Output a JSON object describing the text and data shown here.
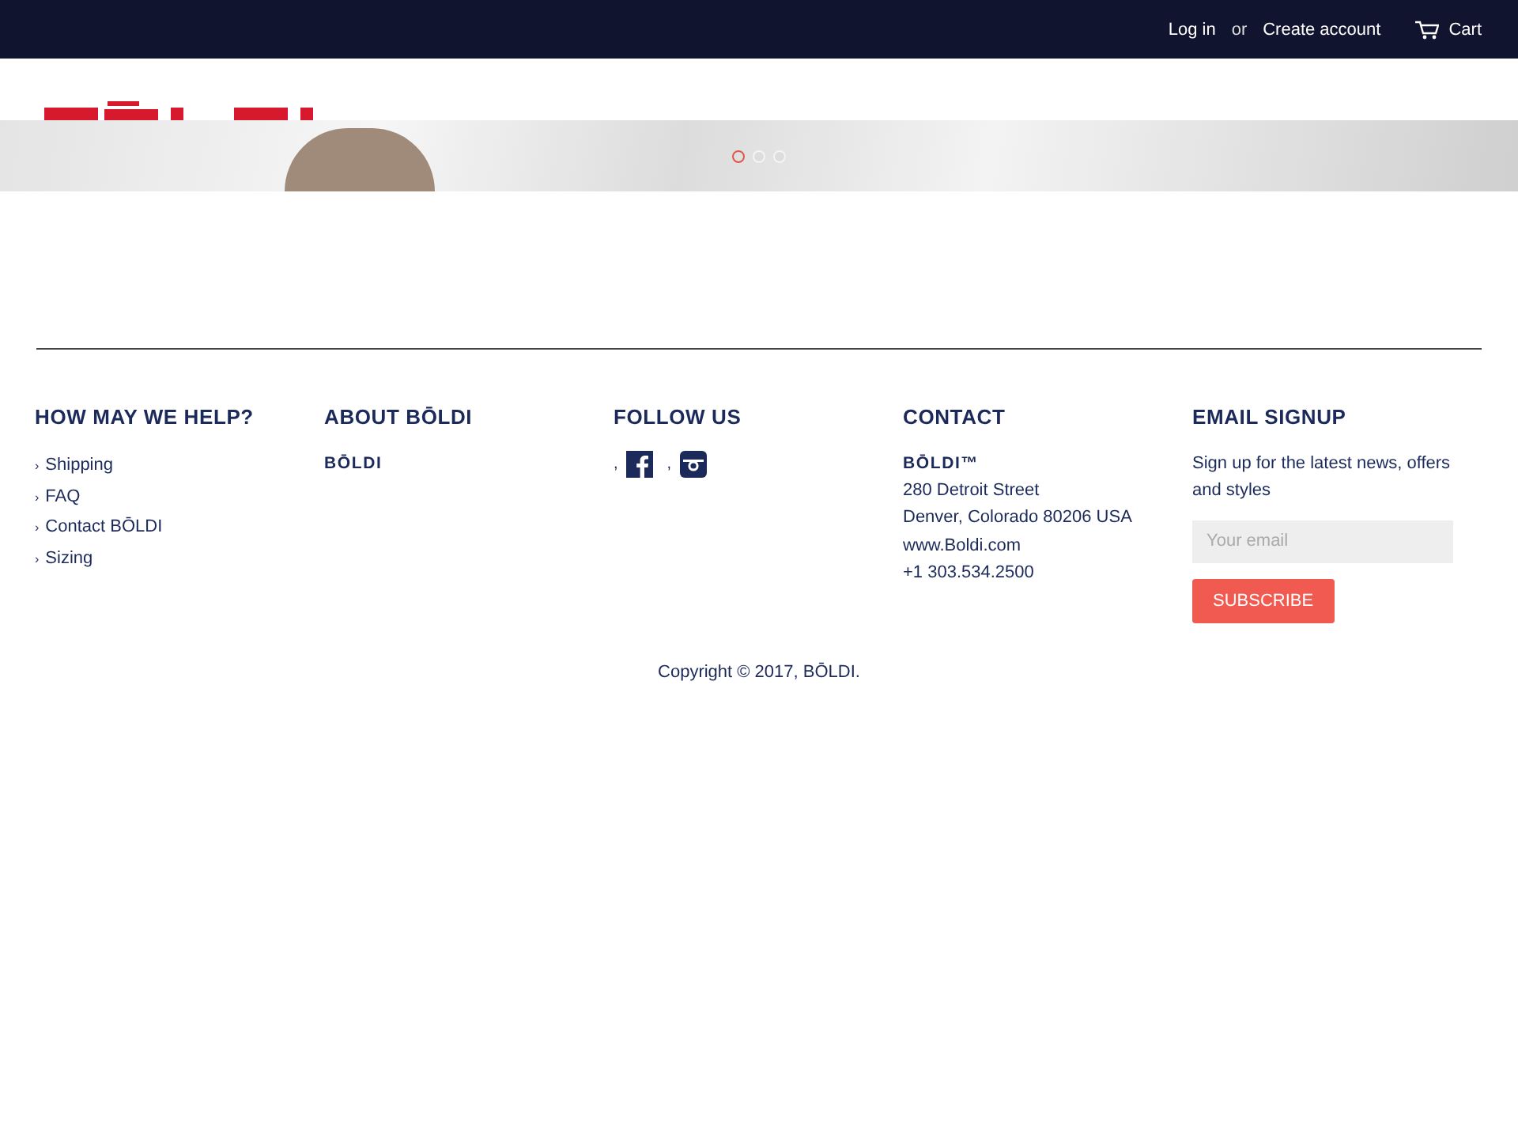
{
  "top_bar": {
    "login": "Log in",
    "separator": "or",
    "create_account": "Create account",
    "cart": "Cart"
  },
  "slideshow": {
    "dots": [
      {
        "selected": true
      },
      {
        "selected": false
      },
      {
        "selected": false
      }
    ]
  },
  "footer": {
    "columns": [
      {
        "kind": "links",
        "heading": "HOW MAY WE HELP?",
        "items": [
          {
            "bullet": "›",
            "label": "Shipping"
          },
          {
            "bullet": "›",
            "label": "FAQ"
          },
          {
            "bullet": "›",
            "label": "Contact BŌLDI"
          },
          {
            "bullet": "›",
            "label": "Sizing"
          }
        ]
      },
      {
        "kind": "about",
        "heading": "ABOUT BŌLDI",
        "text": "BŌLDI"
      },
      {
        "kind": "social",
        "heading": "FOLLOW US",
        "icons": [
          {
            "kind": "facebook",
            "separator": ","
          },
          {
            "kind": "instagram",
            "separator": ","
          }
        ]
      },
      {
        "kind": "contact",
        "heading": "CONTACT",
        "name": "BŌLDI™",
        "lines": [
          "280 Detroit Street",
          "Denver, Colorado 80206 USA",
          "www.Boldi.com",
          "+1 303.534.2500"
        ]
      },
      {
        "kind": "signup",
        "heading": "EMAIL SIGNUP",
        "text": "Sign up for the latest news, offers and styles",
        "placeholder": "Your email",
        "button": "SUBSCRIBE"
      }
    ]
  },
  "copyright": "Copyright © 2017, BŌLDI."
}
